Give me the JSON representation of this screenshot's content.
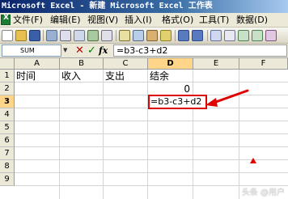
{
  "window": {
    "title": "Microsoft Excel - 新建 Microsoft Excel 工作表"
  },
  "menu": {
    "items": [
      "文件(F)",
      "编辑(E)",
      "视图(V)",
      "插入(I)",
      "格式(O)",
      "工具(T)",
      "数据(D)"
    ]
  },
  "toolbar": {
    "font_size_label": " "
  },
  "formula_bar": {
    "name_box": "SUM",
    "cancel_icon": "✕",
    "enter_icon": "✓",
    "fx_icon": "fx",
    "content": "=b3-c3+d2"
  },
  "sheet": {
    "columns": [
      "A",
      "B",
      "C",
      "D",
      "E",
      "F"
    ],
    "active_column": "D",
    "rows": [
      "1",
      "2",
      "3",
      "4",
      "5",
      "6",
      "7",
      "8",
      "9"
    ],
    "active_row": "3",
    "cells": {
      "A1": "时间",
      "B1": "收入",
      "C1": "支出",
      "D1": "结余",
      "D2": "0",
      "D3": "=b3-c3+d2"
    }
  },
  "watermark": "头条 @用户"
}
